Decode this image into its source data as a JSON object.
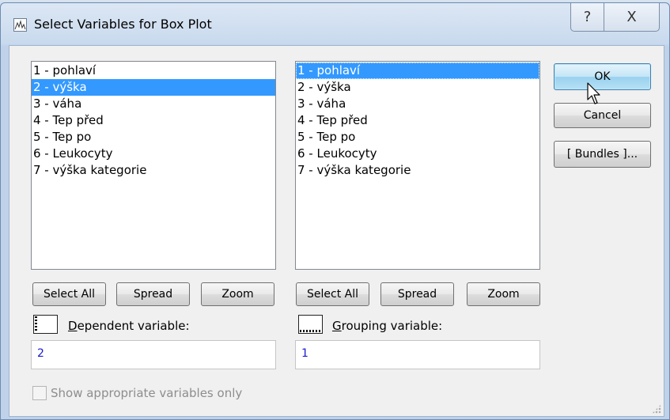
{
  "window": {
    "title": "Select Variables for Box Plot",
    "help_glyph": "?",
    "close_glyph": "X"
  },
  "left_list": {
    "items": [
      "1 - pohlaví",
      "2 - výška",
      "3 - váha",
      "4 - Tep před",
      "5 - Tep po",
      "6 - Leukocyty",
      "7 - výška kategorie"
    ],
    "selected_index": 1
  },
  "right_list": {
    "items": [
      "1 - pohlaví",
      "2 - výška",
      "3 - váha",
      "4 - Tep před",
      "5 - Tep po",
      "6 - Leukocyty",
      "7 - výška kategorie"
    ],
    "selected_index": 0
  },
  "left_buttons": {
    "select_all": "Select All",
    "spread": "Spread",
    "zoom": "Zoom"
  },
  "right_buttons": {
    "select_all": "Select All",
    "spread": "Spread",
    "zoom": "Zoom"
  },
  "dependent": {
    "label_first": "D",
    "label_rest": "ependent variable:",
    "value": "2"
  },
  "grouping": {
    "label_first": "G",
    "label_rest": "rouping variable:",
    "value": "1"
  },
  "side_buttons": {
    "ok": "OK",
    "cancel": "Cancel",
    "bundles": "[ Bundles ]..."
  },
  "options": {
    "show_appropriate": "Show appropriate variables only",
    "show_appropriate_checked": false
  }
}
